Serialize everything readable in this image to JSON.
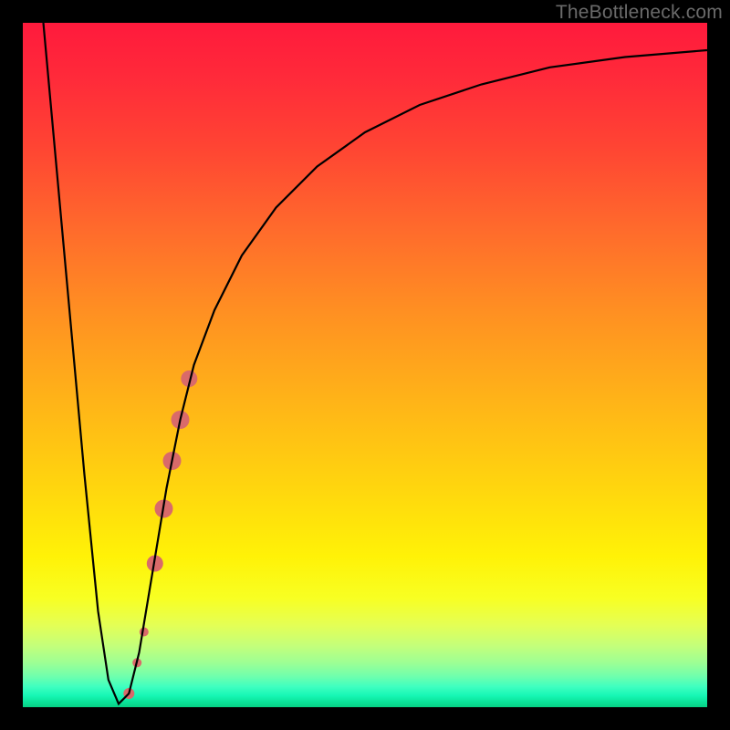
{
  "watermark": "TheBottleneck.com",
  "chart_data": {
    "type": "line",
    "title": "",
    "xlabel": "",
    "ylabel": "",
    "xlim": [
      0,
      100
    ],
    "ylim": [
      0,
      100
    ],
    "grid": false,
    "legend": false,
    "background_gradient": {
      "top": "#ff1a3c",
      "mid": "#ffd60e",
      "bottom": "#07d084"
    },
    "series": [
      {
        "name": "bottleneck-curve",
        "color": "#000000",
        "x": [
          3,
          5,
          7,
          9,
          11,
          12.5,
          14,
          15.5,
          17,
          19,
          21,
          23,
          25,
          28,
          32,
          37,
          43,
          50,
          58,
          67,
          77,
          88,
          100
        ],
        "y": [
          100,
          78,
          56,
          34,
          14,
          4,
          0.5,
          2,
          8,
          20,
          32,
          42,
          50,
          58,
          66,
          73,
          79,
          84,
          88,
          91,
          93.5,
          95,
          96
        ]
      }
    ],
    "highlight": {
      "name": "highlighted-segment",
      "color": "#d96a6a",
      "points": [
        {
          "x": 15.5,
          "y": 2,
          "r": 6
        },
        {
          "x": 16.7,
          "y": 6.5,
          "r": 5
        },
        {
          "x": 17.7,
          "y": 11,
          "r": 5
        },
        {
          "x": 19.3,
          "y": 21,
          "r": 9
        },
        {
          "x": 20.6,
          "y": 29,
          "r": 10
        },
        {
          "x": 21.8,
          "y": 36,
          "r": 10
        },
        {
          "x": 23.0,
          "y": 42,
          "r": 10
        },
        {
          "x": 24.3,
          "y": 48,
          "r": 9
        }
      ]
    }
  }
}
